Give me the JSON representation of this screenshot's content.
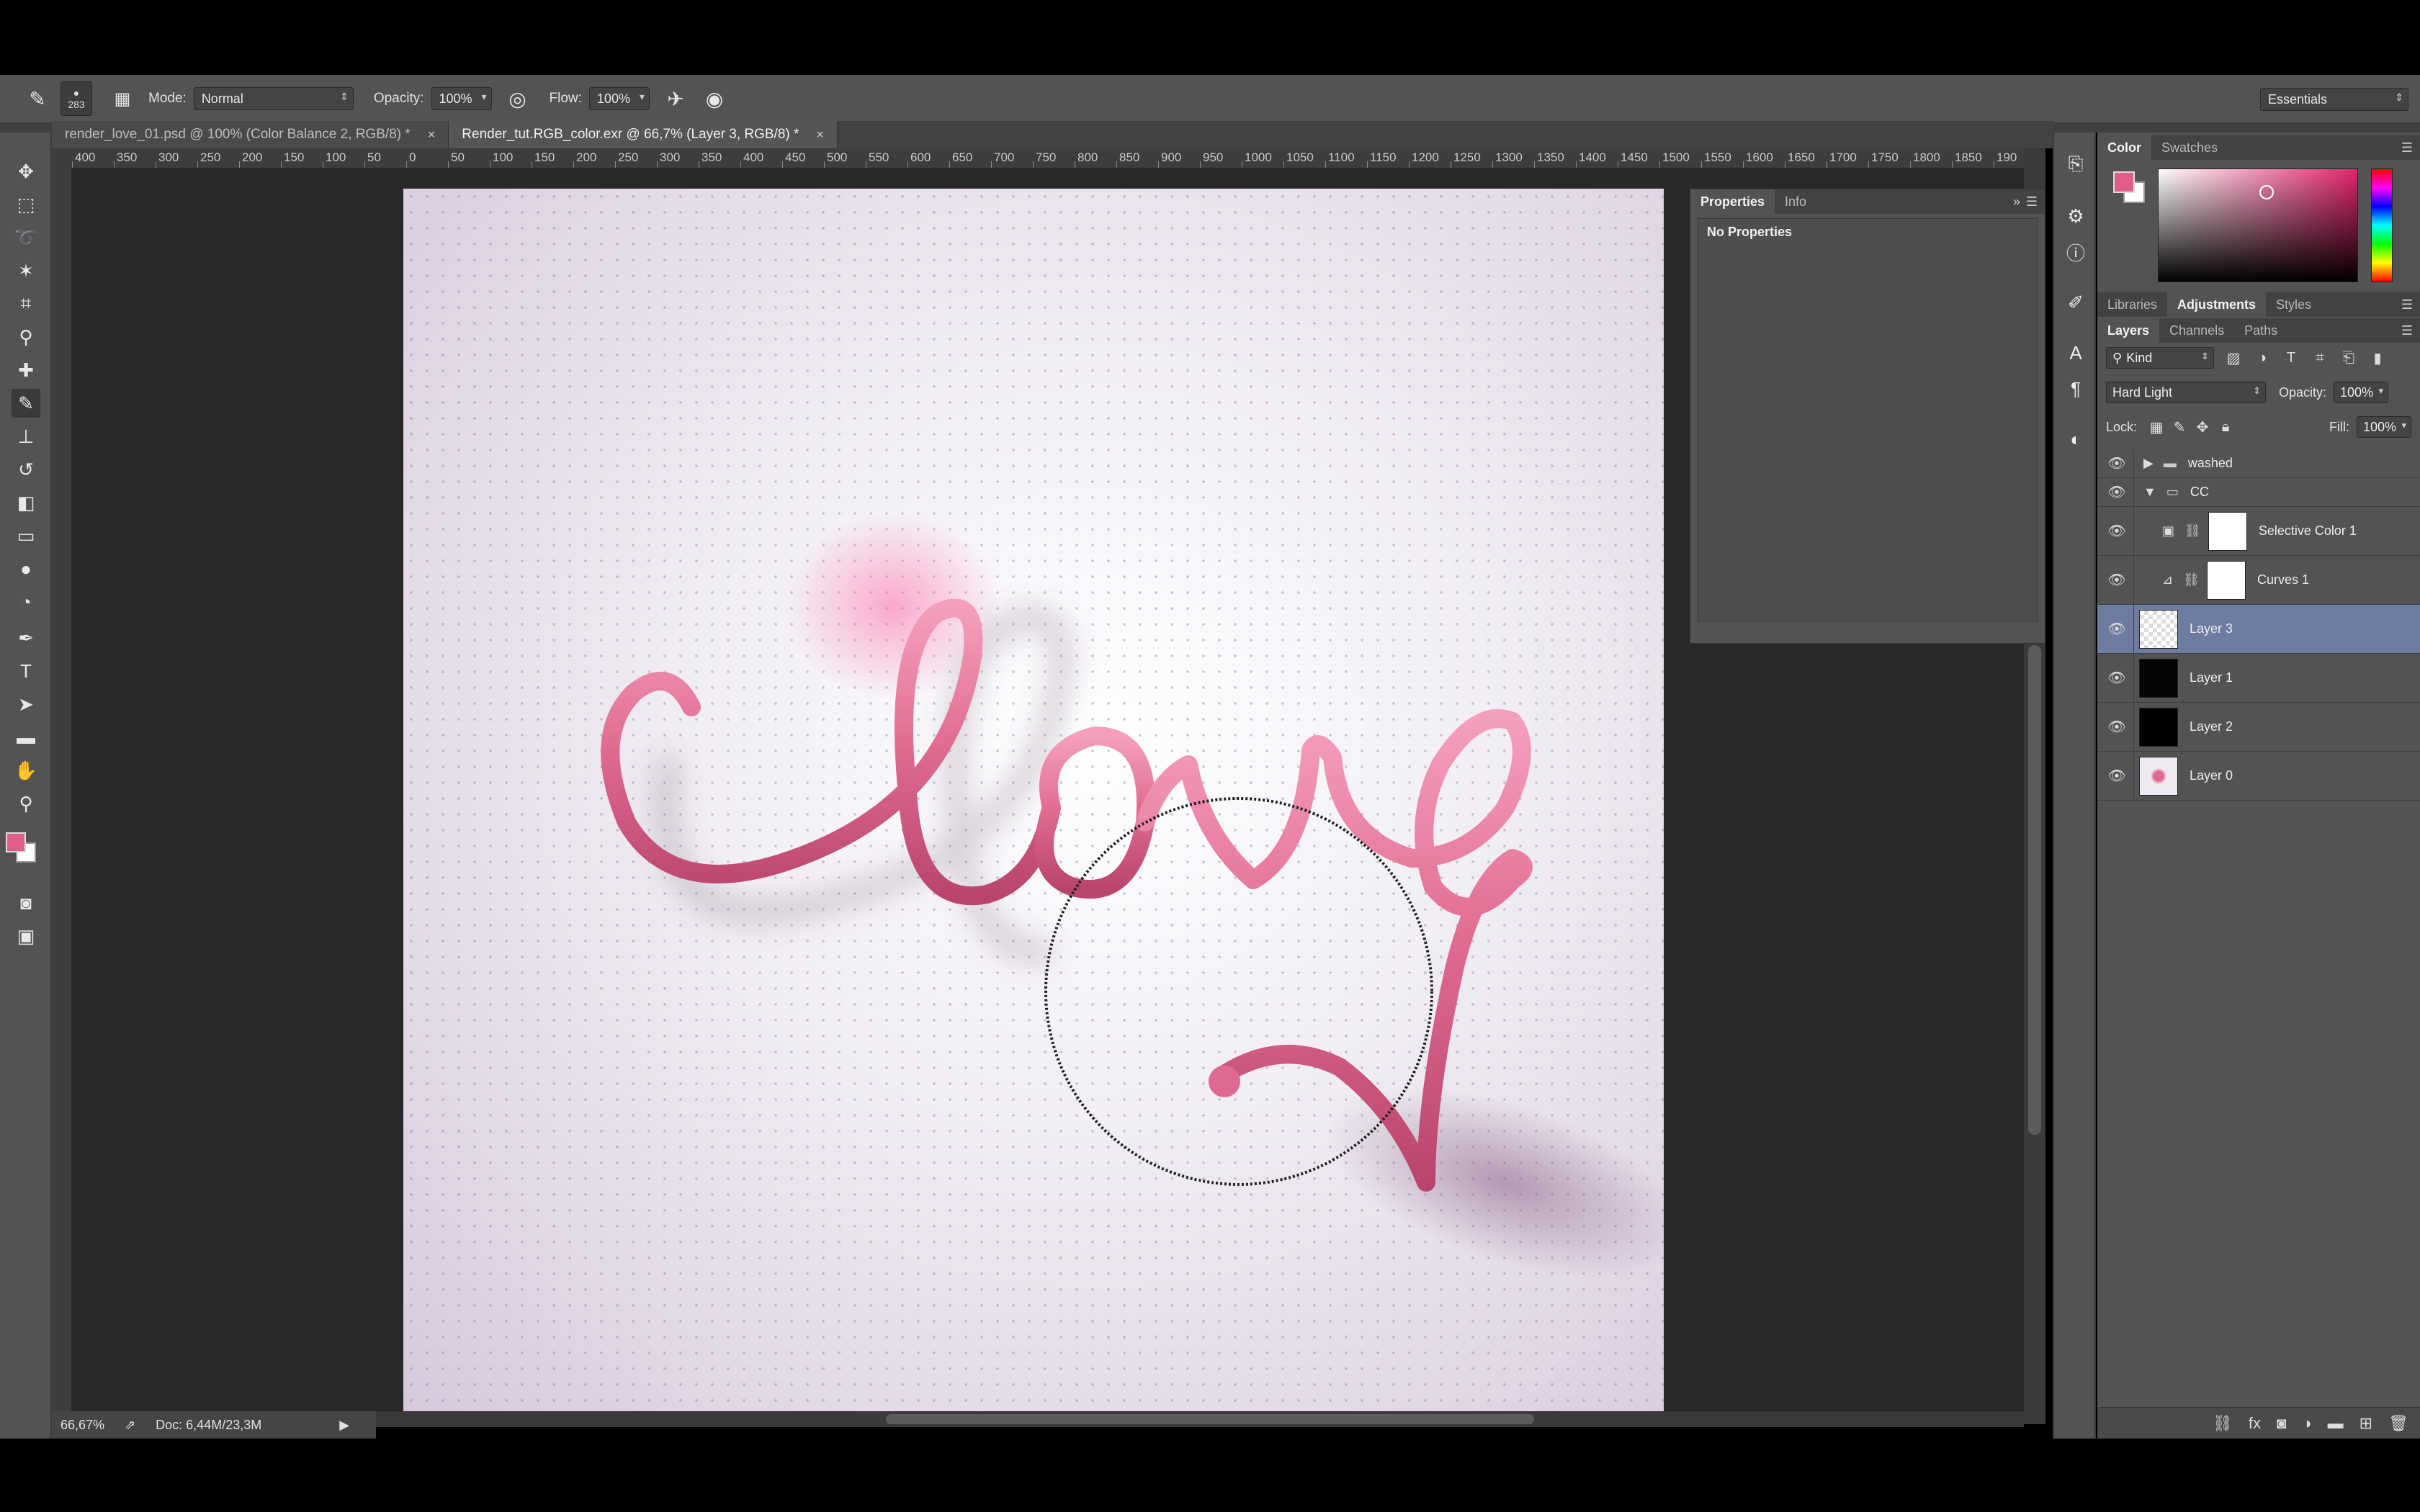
{
  "options_bar": {
    "brush_size": "283",
    "mode_label": "Mode:",
    "mode_value": "Normal",
    "opacity_label": "Opacity:",
    "opacity_value": "100%",
    "flow_label": "Flow:",
    "flow_value": "100%",
    "workspace": "Essentials"
  },
  "tabs": [
    {
      "title": "render_love_01.psd @ 100% (Color Balance 2, RGB/8) *",
      "close": "×"
    },
    {
      "title": "Render_tut.RGB_color.exr @ 66,7% (Layer 3, RGB/8) *",
      "close": "×"
    }
  ],
  "ruler_labels": [
    "400",
    "350",
    "300",
    "250",
    "200",
    "150",
    "100",
    "50",
    "0",
    "50",
    "100",
    "150",
    "200",
    "250",
    "300",
    "350",
    "400",
    "450",
    "500",
    "550",
    "600",
    "650",
    "700",
    "750",
    "800",
    "850",
    "900",
    "950",
    "1000",
    "1050",
    "1100",
    "1150",
    "1200",
    "1250",
    "1300",
    "1350",
    "1400",
    "1450",
    "1500",
    "1550",
    "1600",
    "1650",
    "1700",
    "1750",
    "1800",
    "1850",
    "190"
  ],
  "status": {
    "zoom": "66,67%",
    "doc": "Doc: 6,44M/23,3M"
  },
  "properties": {
    "tabs": [
      "Properties",
      "Info"
    ],
    "body": "No Properties"
  },
  "color_panel": {
    "tabs": [
      "Color",
      "Swatches"
    ],
    "fg_color": "#e05c8a",
    "bg_color": "#ffffff"
  },
  "adjust_tabs": [
    "Libraries",
    "Adjustments",
    "Styles"
  ],
  "layers_panel": {
    "tabs": [
      "Layers",
      "Channels",
      "Paths"
    ],
    "filter": "Kind",
    "blend_mode": "Hard Light",
    "opacity_label": "Opacity:",
    "opacity_value": "100%",
    "lock_label": "Lock:",
    "fill_label": "Fill:",
    "fill_value": "100%",
    "layers": [
      {
        "name": "washed",
        "type": "group"
      },
      {
        "name": "CC",
        "type": "group"
      },
      {
        "name": "Selective Color 1",
        "type": "adjustment"
      },
      {
        "name": "Curves 1",
        "type": "adjustment"
      },
      {
        "name": "Layer 3",
        "type": "pixel",
        "selected": true
      },
      {
        "name": "Layer 1",
        "type": "pixel"
      },
      {
        "name": "Layer 2",
        "type": "pixel"
      },
      {
        "name": "Layer 0",
        "type": "pixel"
      }
    ]
  },
  "accent_colors": {
    "tube_pink": "#e06a8f",
    "selection_blue": "#6d7ca0"
  }
}
